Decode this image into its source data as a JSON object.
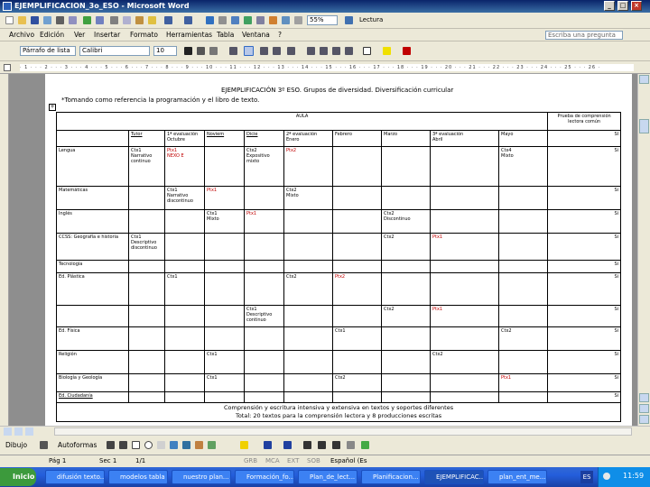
{
  "window": {
    "title": "EJEMPLIFICACION_3o_ESO - Microsoft Word",
    "buttons": {
      "minimize": "_",
      "maximize": "□",
      "close": "×"
    }
  },
  "toolbar_standard": {
    "zoom": "55%",
    "reading_label": "Lectura"
  },
  "menu": {
    "items": [
      "Archivo",
      "Edición",
      "Ver",
      "Insertar",
      "Formato",
      "Herramientas",
      "Tabla",
      "Ventana",
      "?"
    ],
    "help_placeholder": "Escriba una pregunta"
  },
  "toolbar_format": {
    "style": "Párrafo de lista",
    "font": "Calibri",
    "size": "10"
  },
  "ruler": {
    "marks": "· 1 · · · 2 · · · 3 · · · 4 · · · 5 · · · 6 · · · 7 · · · 8 · · · 9 · · · 10 · · · 11 · · · 12 · · · 13 · · · 14 · · · 15 · · · 16 · · · 17 · · · 18 · · · 19 · · · 20 · · · 21 · · · 22 · · · 23 · · · 24 · · · 25 · · · 26 ·"
  },
  "document": {
    "heading": "EJEMPLIFICACIÓN 3º ESO. Grupos de diversidad. Diversificación curricular",
    "intro": "*Tomando como referencia la programación y el libro de texto.",
    "table": {
      "aula_header": "AULA",
      "prueba_header": "Prueba de comprensión",
      "prueba_sub": "lectora común",
      "col_headers": {
        "tutor": "Tutor",
        "ev1": "1ª evaluación",
        "octubre": "Octubre",
        "nov": "Noviem",
        "dic": "Dicie",
        "ev2": "2ª evaluación",
        "enero": "Enero",
        "febrero": "Febrero",
        "marzo": "Marzo",
        "ev3": "3ª evaluación",
        "abril": "Abril",
        "mayo": "Mayo",
        "si": "SI"
      },
      "rows": [
        {
          "subject": "Lengua",
          "tutor": "Ctx1\nNarrativo\ncontinuo",
          "oct": "Ptx1\nNEXO E",
          "nov": "",
          "dic": "Ctx2\nExpositivo\nmixto",
          "ene": "Ptx2",
          "feb": "",
          "mar": "",
          "abr": "",
          "may": "Ctx4\nMixto",
          "si": "Si"
        },
        {
          "subject": "Matemáticas",
          "tutor": "",
          "oct": "Ctx1\nNarrativo\ndiscontinuo",
          "nov": "Ptx1",
          "dic": "",
          "ene": "Ctx2\nMixto",
          "feb": "",
          "mar": "",
          "abr": "",
          "may": "",
          "si": "Si"
        },
        {
          "subject": "Inglés",
          "tutor": "",
          "oct": "",
          "nov": "Ctx1\nMixto",
          "dic": "Ptx1",
          "ene": "",
          "feb": "",
          "mar": "Ctx2\nDiscontinuo",
          "abr": "",
          "may": "",
          "si": "Si"
        },
        {
          "subject": "CCSS: Geografía e historia",
          "tutor": "Ctx1\nDescriptivo\ndiscontinuo",
          "oct": "",
          "nov": "",
          "dic": "",
          "ene": "",
          "feb": "",
          "mar": "Ctx2",
          "abr": "Ptx1",
          "may": "",
          "si": "Si"
        },
        {
          "subject": "Tecnología",
          "tutor": "",
          "oct": "",
          "nov": "",
          "dic": "",
          "ene": "",
          "feb": "",
          "mar": "",
          "abr": "",
          "may": "",
          "si": "Si"
        },
        {
          "subject": "Ed. Plástica",
          "tutor": "",
          "oct": "Ctx1",
          "nov": "",
          "dic": "",
          "ene": "Ctx2",
          "feb": "Ptx2",
          "mar": "",
          "abr": "",
          "may": "",
          "si": "Si"
        },
        {
          "subject": "",
          "tutor": "",
          "oct": "",
          "nov": "",
          "dic": "Ctx1\nDescriptivo\ncontinuo",
          "ene": "",
          "feb": "",
          "mar": "Ctx2",
          "abr": "Ptx1",
          "may": "",
          "si": "Si"
        },
        {
          "subject": "Ed. Física",
          "tutor": "",
          "oct": "",
          "nov": "",
          "dic": "",
          "ene": "",
          "feb": "Ctx1",
          "mar": "",
          "abr": "",
          "may": "Ctx2",
          "si": "Si"
        },
        {
          "subject": "Religión",
          "tutor": "",
          "oct": "",
          "nov": "Ctx1",
          "dic": "",
          "ene": "",
          "feb": "",
          "mar": "",
          "abr": "Ctx2",
          "may": "",
          "si": "Si"
        },
        {
          "subject": "Biología y Geología",
          "tutor": "",
          "oct": "",
          "nov": "Ctx1",
          "dic": "",
          "ene": "",
          "feb": "Ctx2",
          "mar": "",
          "abr": "",
          "may": "Ptx1",
          "si": "Si"
        },
        {
          "subject": "Ed. Ciudadanía",
          "tutor": "",
          "oct": "",
          "nov": "",
          "dic": "",
          "ene": "",
          "feb": "",
          "mar": "",
          "abr": "",
          "may": "",
          "si": "Si"
        }
      ],
      "footer1": "Comprensión y escritura intensiva y extensiva en textos y soportes diferentes",
      "footer2": "Total: 20 textos para la comprensión lectora y 8 producciones escritas"
    }
  },
  "drawing_toolbar": {
    "draw_label": "Dibujo",
    "autoshapes_label": "Autoformas"
  },
  "status": {
    "page": "Pág 1",
    "section": "Sec 1",
    "pos": "1/1",
    "flags": [
      "GRB",
      "MCA",
      "EXT",
      "SOB"
    ],
    "language": "Español (Es"
  },
  "taskbar": {
    "start": "Inicio",
    "tasks": [
      "difusión texto...",
      "modelos tabla",
      "nuestro plan...",
      "Formación_fo...",
      "Plan_de_lect...",
      "Planificacion...",
      "EJEMPLIFICAC...",
      "plan_ent_me..."
    ],
    "lang": "ES",
    "clock": "11:59"
  }
}
